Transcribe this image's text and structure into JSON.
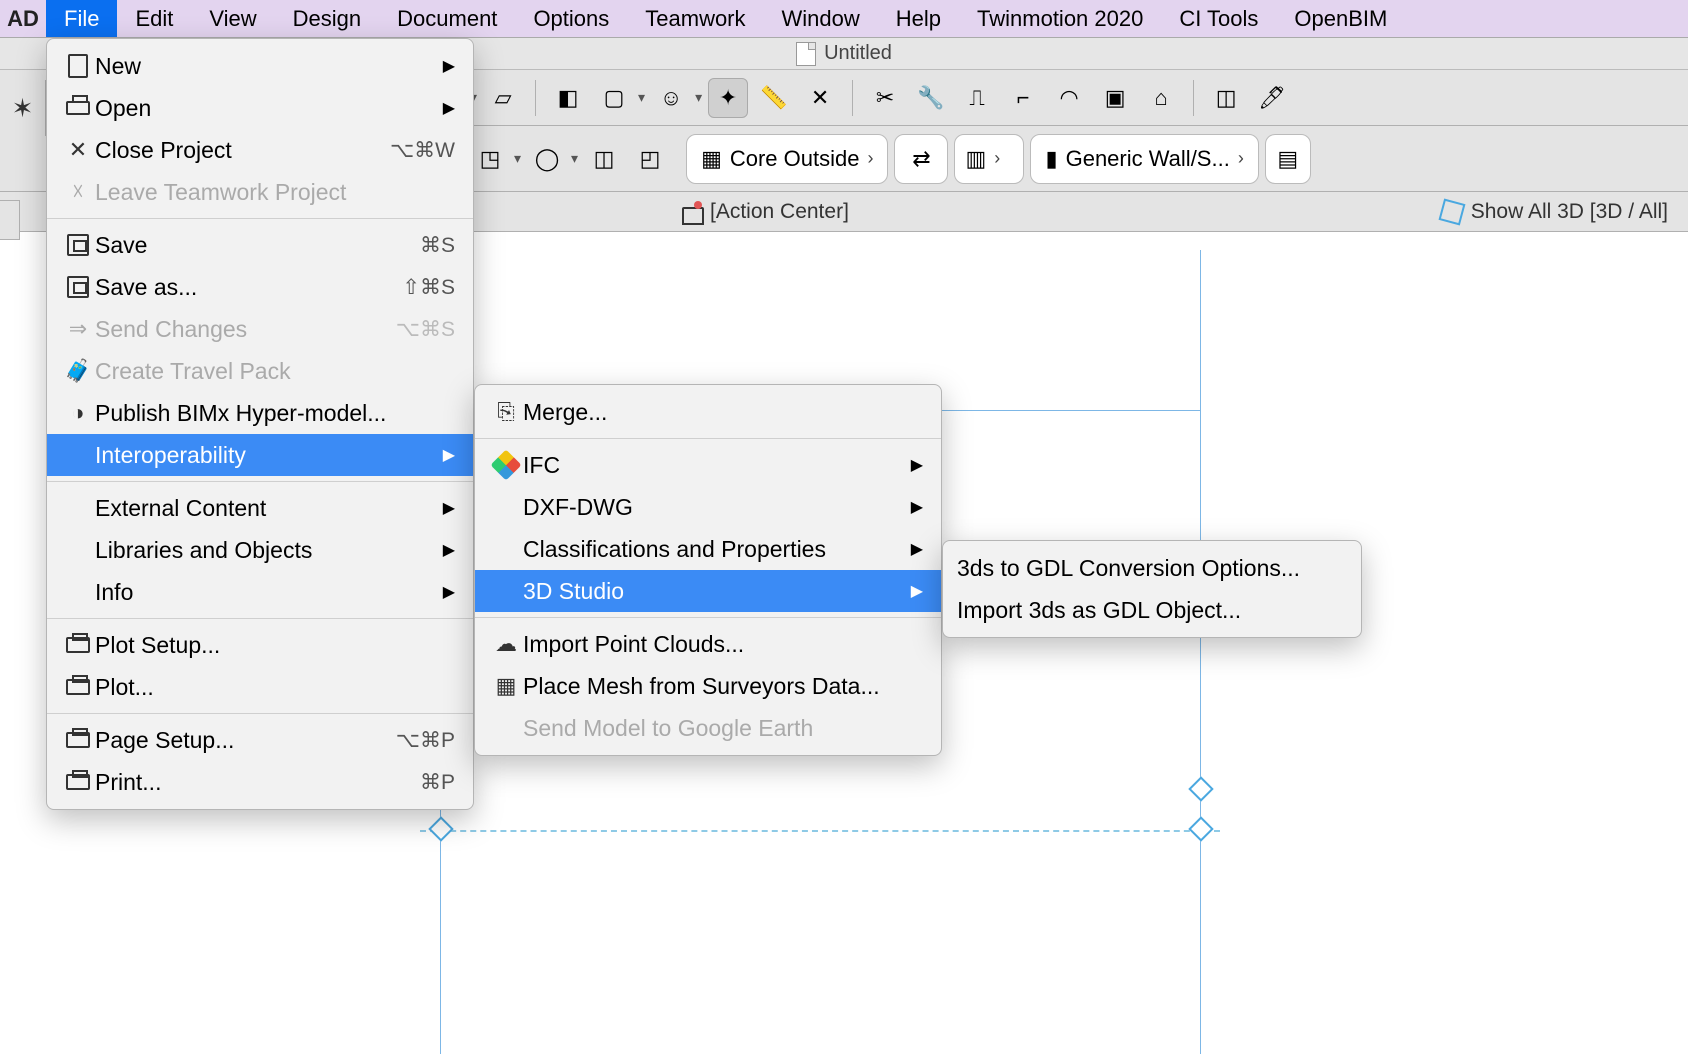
{
  "menubar": {
    "logo": "AD",
    "items": [
      "File",
      "Edit",
      "View",
      "Design",
      "Document",
      "Options",
      "Teamwork",
      "Window",
      "Help",
      "Twinmotion 2020",
      "CI Tools",
      "OpenBIM"
    ],
    "active_index": 0
  },
  "titlebar": {
    "title": "Untitled"
  },
  "toolbar_row2": {
    "core_label": "Core Outside",
    "wall_label": "Generic Wall/S..."
  },
  "statusbar": {
    "action_center": "[Action Center]",
    "show3d": "Show All 3D [3D / All]"
  },
  "file_menu": {
    "groups": [
      [
        {
          "label": "New",
          "shortcut": "",
          "icon": "new",
          "sub": true
        },
        {
          "label": "Open",
          "shortcut": "",
          "icon": "open",
          "sub": true
        },
        {
          "label": "Close Project",
          "shortcut": "⌥⌘W",
          "icon": "close"
        },
        {
          "label": "Leave Teamwork Project",
          "shortcut": "",
          "icon": "leave",
          "disabled": true
        }
      ],
      [
        {
          "label": "Save",
          "shortcut": "⌘S",
          "icon": "save"
        },
        {
          "label": "Save as...",
          "shortcut": "⇧⌘S",
          "icon": "saveas"
        },
        {
          "label": "Send Changes",
          "shortcut": "⌥⌘S",
          "icon": "send",
          "disabled": true
        },
        {
          "label": "Create Travel Pack",
          "shortcut": "",
          "icon": "pack",
          "disabled": true
        },
        {
          "label": "Publish BIMx Hyper-model...",
          "shortcut": "",
          "icon": "bimx"
        },
        {
          "label": "Interoperability",
          "shortcut": "",
          "icon": "",
          "sub": true,
          "selected": true
        }
      ],
      [
        {
          "label": "External Content",
          "shortcut": "",
          "icon": "",
          "sub": true
        },
        {
          "label": "Libraries and Objects",
          "shortcut": "",
          "icon": "",
          "sub": true
        },
        {
          "label": "Info",
          "shortcut": "",
          "icon": "",
          "sub": true
        }
      ],
      [
        {
          "label": "Plot Setup...",
          "shortcut": "",
          "icon": "plotset"
        },
        {
          "label": "Plot...",
          "shortcut": "",
          "icon": "plot"
        }
      ],
      [
        {
          "label": "Page Setup...",
          "shortcut": "⌥⌘P",
          "icon": "pageset"
        },
        {
          "label": "Print...",
          "shortcut": "⌘P",
          "icon": "print"
        }
      ]
    ]
  },
  "interop_menu": {
    "groups": [
      [
        {
          "label": "Merge...",
          "icon": "merge"
        }
      ],
      [
        {
          "label": "IFC",
          "icon": "ifc",
          "sub": true
        },
        {
          "label": "DXF-DWG",
          "icon": "",
          "sub": true
        },
        {
          "label": "Classifications and Properties",
          "icon": "",
          "sub": true
        },
        {
          "label": "3D Studio",
          "icon": "",
          "sub": true,
          "selected": true
        }
      ],
      [
        {
          "label": "Import Point Clouds...",
          "icon": "cloud"
        },
        {
          "label": "Place Mesh from Surveyors Data...",
          "icon": "mesh"
        },
        {
          "label": "Send Model to Google Earth",
          "icon": "",
          "disabled": true
        }
      ]
    ]
  },
  "studio_menu": {
    "items": [
      {
        "label": "3ds to GDL Conversion Options..."
      },
      {
        "label": "Import 3ds as GDL Object..."
      }
    ]
  }
}
